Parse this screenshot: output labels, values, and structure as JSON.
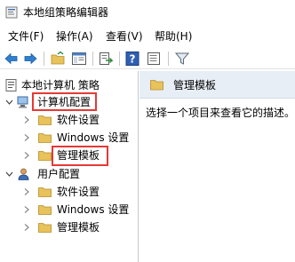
{
  "window": {
    "title": "本地组策略编辑器"
  },
  "menu": [
    {
      "label": "文件(F)"
    },
    {
      "label": "操作(A)"
    },
    {
      "label": "查看(V)"
    },
    {
      "label": "帮助(H)"
    }
  ],
  "tree": {
    "root": "本地计算机 策略",
    "computer_config": "计算机配置",
    "cc_software": "软件设置",
    "cc_windows": "Windows 设置",
    "cc_admin": "管理模板",
    "user_config": "用户配置",
    "uc_software": "软件设置",
    "uc_windows": "Windows 设置",
    "uc_admin": "管理模板"
  },
  "details": {
    "header": "管理模板",
    "description": "选择一个项目来查看它的描述。"
  },
  "colors": {
    "highlight": "#e53935",
    "folder": "#e8c25a",
    "header_bg": "#e8eef6"
  },
  "icons": [
    "back-arrow-icon",
    "forward-arrow-icon",
    "up-folder-icon",
    "show-hide-tree-icon",
    "export-list-icon",
    "help-icon",
    "properties-icon",
    "filter-icon"
  ]
}
